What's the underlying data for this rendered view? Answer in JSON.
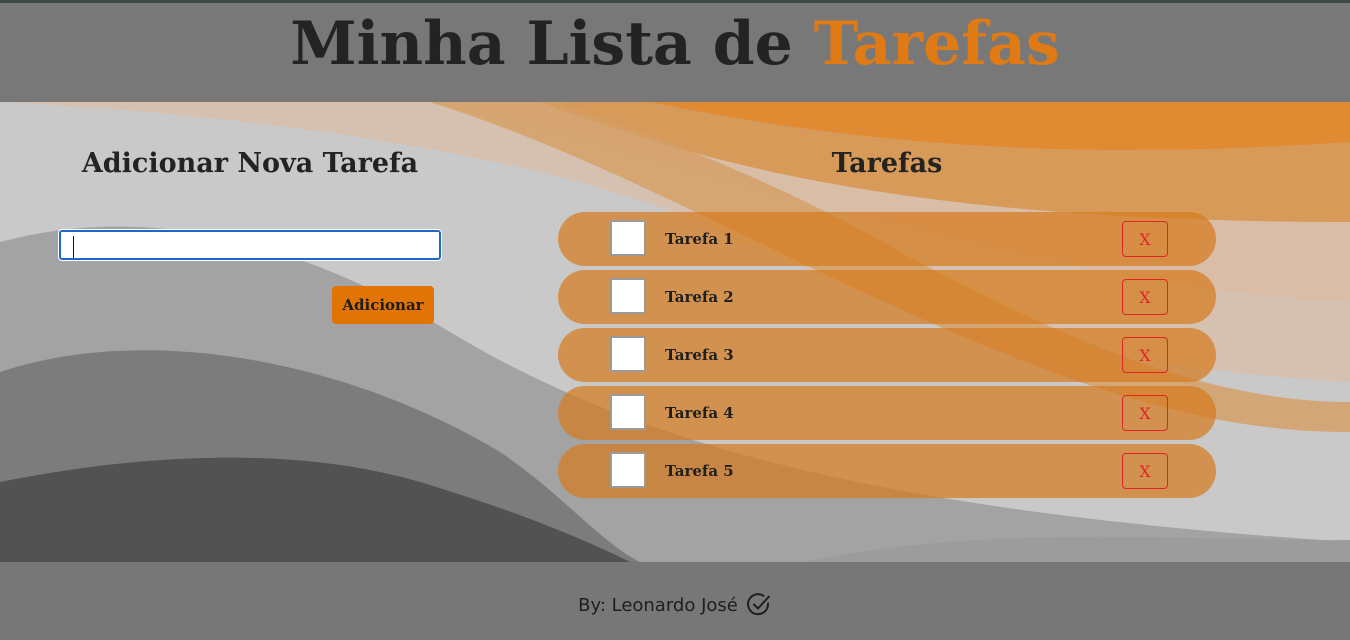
{
  "header": {
    "title_main": "Minha Lista de",
    "title_accent": "Tarefas"
  },
  "add_panel": {
    "heading": "Adicionar Nova Tarefa",
    "input_value": "",
    "input_placeholder": "",
    "button_label": "Adicionar"
  },
  "tasks_panel": {
    "heading": "Tarefas",
    "tasks": [
      {
        "label": "Tarefa 1",
        "checked": false,
        "delete_label": "X"
      },
      {
        "label": "Tarefa 2",
        "checked": false,
        "delete_label": "X"
      },
      {
        "label": "Tarefa 3",
        "checked": false,
        "delete_label": "X"
      },
      {
        "label": "Tarefa 4",
        "checked": false,
        "delete_label": "X"
      },
      {
        "label": "Tarefa 5",
        "checked": false,
        "delete_label": "X"
      }
    ]
  },
  "footer": {
    "credit": "By: Leonardo José",
    "icon": "check-circle-icon"
  },
  "colors": {
    "accent": "#e07a14",
    "button": "#e07405",
    "delete": "#e02626",
    "header_bg": "#787878"
  }
}
